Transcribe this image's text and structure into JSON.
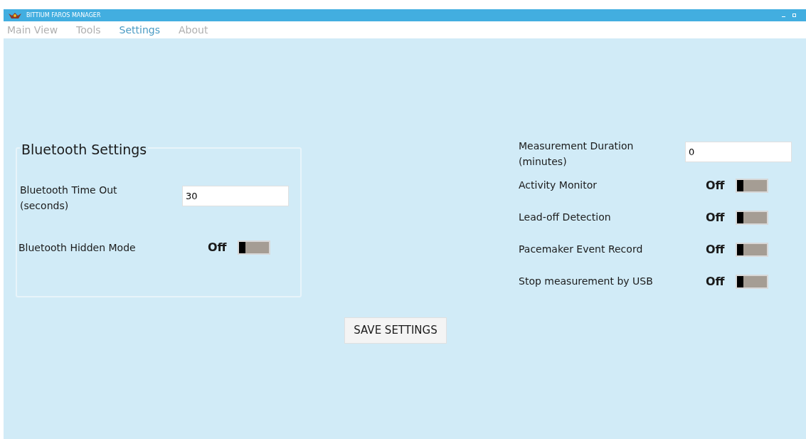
{
  "window": {
    "title": "BITTIUM FAROS MANAGER"
  },
  "menu": [
    {
      "label": "Main View",
      "selected": false
    },
    {
      "label": "Tools",
      "selected": false
    },
    {
      "label": "Settings",
      "selected": true
    },
    {
      "label": "About",
      "selected": false
    }
  ],
  "bluetooth": {
    "title": "Bluetooth Settings",
    "timeout": {
      "label": "Bluetooth Time Out (seconds)",
      "value": "30"
    },
    "hidden_mode": {
      "label": "Bluetooth Hidden Mode",
      "state": "Off",
      "on": false
    }
  },
  "measurement_duration": {
    "label": "Measurement Duration (minutes)",
    "value": "0"
  },
  "toggles": [
    {
      "label": "Activity Monitor",
      "state": "Off",
      "on": false
    },
    {
      "label": "Lead-off Detection",
      "state": "Off",
      "on": false
    },
    {
      "label": "Pacemaker Event Record",
      "state": "Off",
      "on": false
    },
    {
      "label": "Stop measurement by USB",
      "state": "Off",
      "on": false
    }
  ],
  "save_button": "SAVE SETTINGS"
}
